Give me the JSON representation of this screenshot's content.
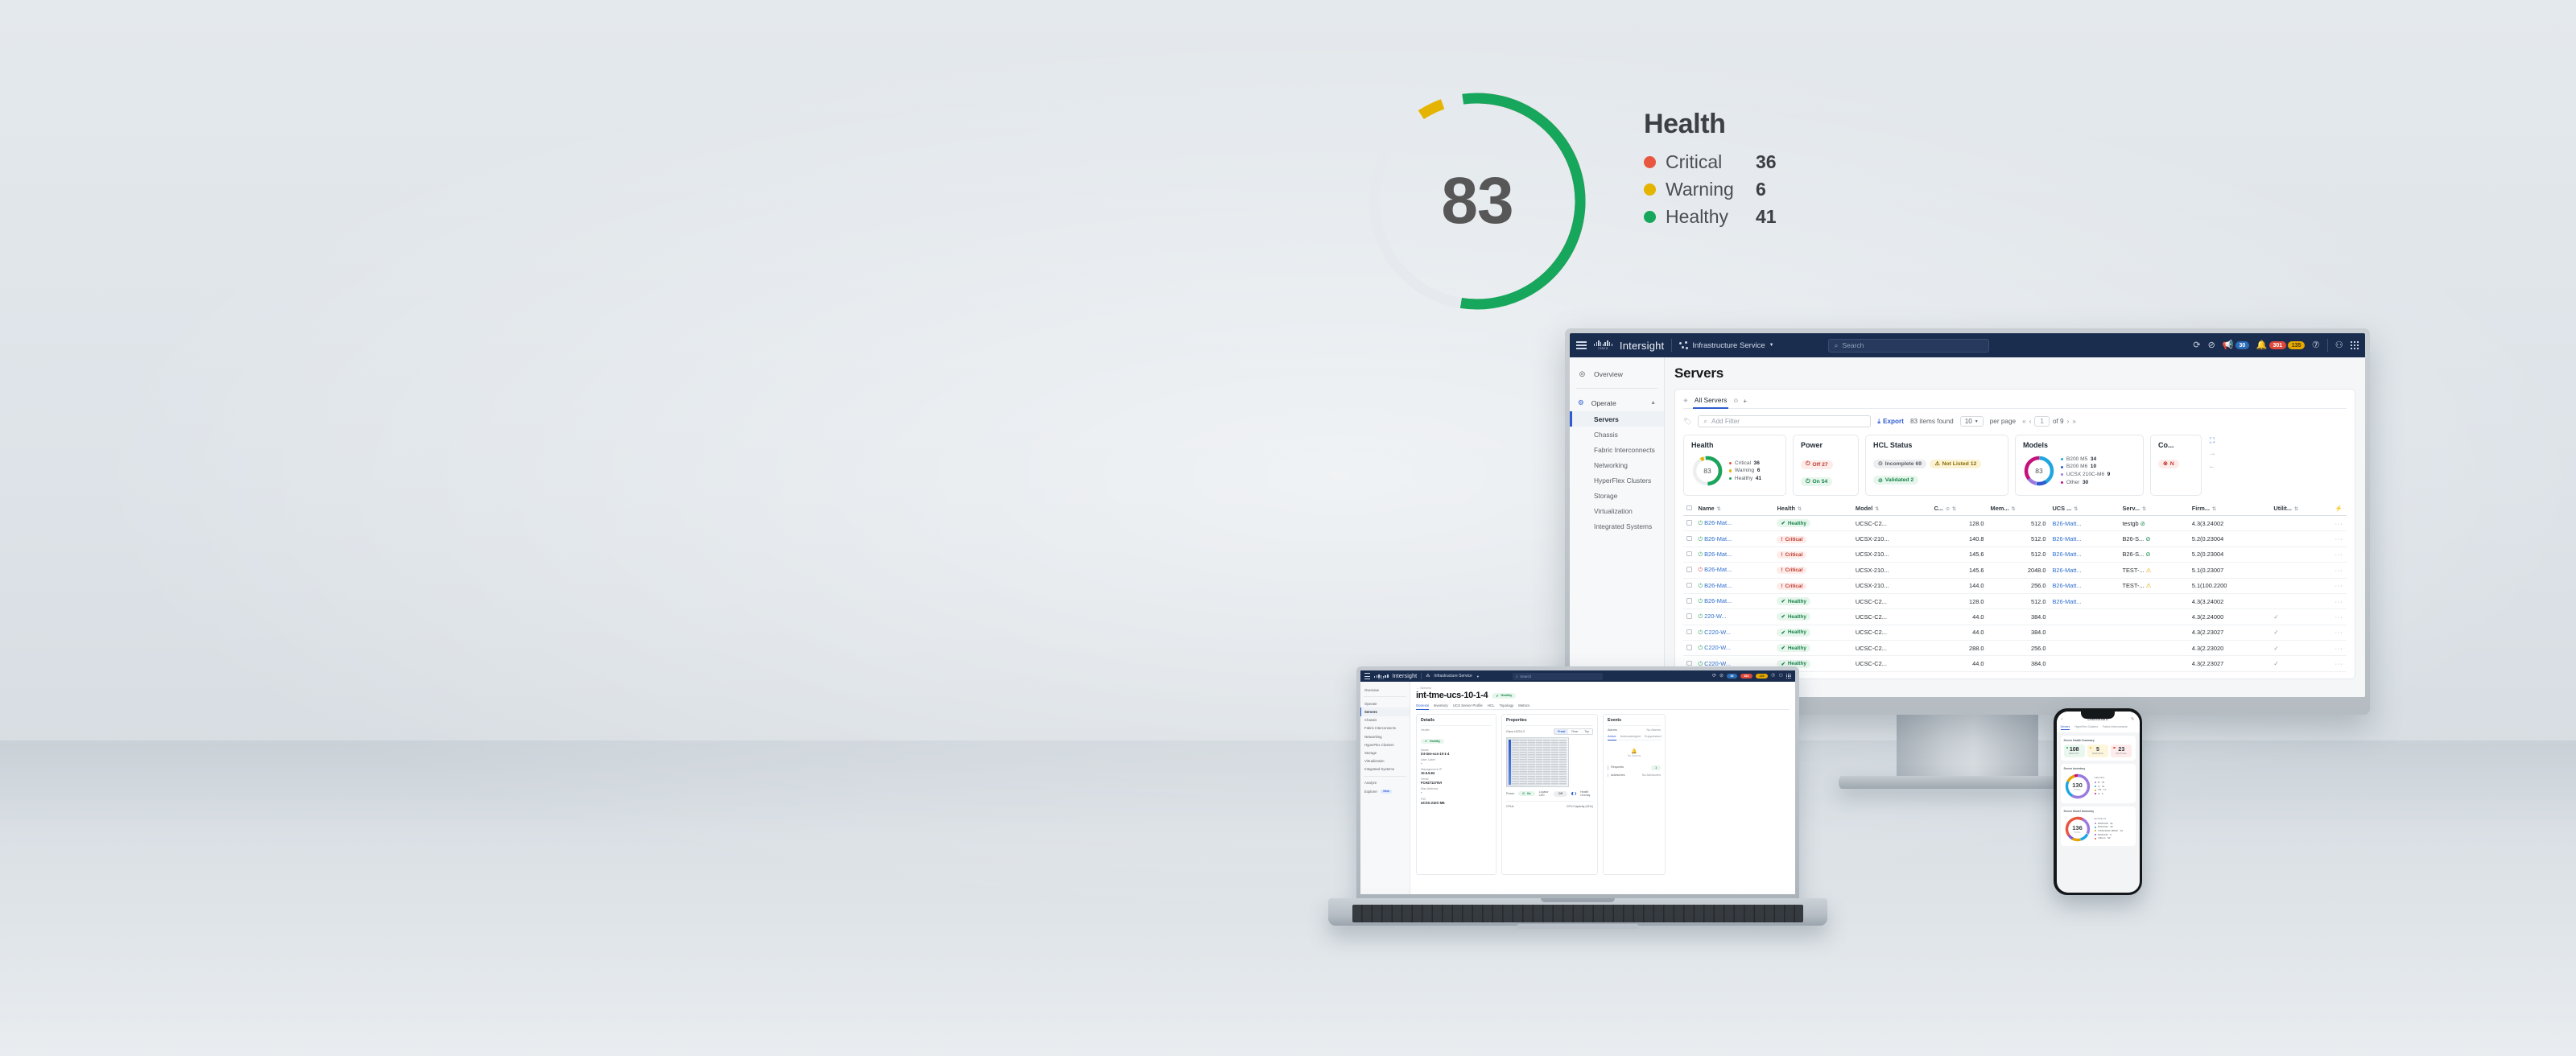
{
  "hero": {
    "score": "83",
    "title": "Health",
    "legend": [
      {
        "label": "Critical",
        "value": "36",
        "color": "#e8563f"
      },
      {
        "label": "Warning",
        "value": "6",
        "color": "#e5b400"
      },
      {
        "label": "Healthy",
        "value": "41",
        "color": "#16a75c"
      }
    ]
  },
  "topbar": {
    "brand": "Intersight",
    "cisco": "cisco",
    "service": "Infrastructure Service",
    "search_placeholder": "Search",
    "badges": [
      {
        "name": "announcements",
        "value": "30",
        "style": "blue"
      },
      {
        "name": "alarms-critical",
        "value": "301",
        "style": "red"
      },
      {
        "name": "alarms-warning",
        "value": "135",
        "style": "amber"
      }
    ]
  },
  "sidebar": {
    "overview": "Overview",
    "operate": "Operate",
    "items": [
      {
        "label": "Servers",
        "active": true
      },
      {
        "label": "Chassis",
        "active": false
      },
      {
        "label": "Fabric Interconnects",
        "active": false
      },
      {
        "label": "Networking",
        "active": false
      },
      {
        "label": "HyperFlex Clusters",
        "active": false
      },
      {
        "label": "Storage",
        "active": false
      },
      {
        "label": "Virtualization",
        "active": false
      },
      {
        "label": "Integrated Systems",
        "active": false
      }
    ]
  },
  "servers_page": {
    "title": "Servers",
    "tab": "All Servers",
    "add_tab": "+",
    "filter_placeholder": "Add Filter",
    "export": "Export",
    "items_found": "83 items found",
    "per_page_value": "10",
    "per_page_label": "per page",
    "page_value": "1",
    "page_of": "of 9"
  },
  "summary": {
    "health": {
      "title": "Health",
      "score": "83",
      "legend": [
        {
          "label": "Critical",
          "value": "36",
          "color": "#e8563f"
        },
        {
          "label": "Warning",
          "value": "6",
          "color": "#e5b400"
        },
        {
          "label": "Healthy",
          "value": "41",
          "color": "#16a75c"
        }
      ]
    },
    "power": {
      "title": "Power",
      "off": "Off 27",
      "on": "On 54"
    },
    "hcl": {
      "title": "HCL Status",
      "incomplete": "Incomplete 69",
      "not_listed": "Not Listed 12",
      "validated": "Validated 2"
    },
    "models": {
      "title": "Models",
      "total": "83",
      "legend": [
        {
          "label": "B200 M5",
          "value": "34",
          "color": "#1fa6e0"
        },
        {
          "label": "B200 M6",
          "value": "10",
          "color": "#2f5bd0"
        },
        {
          "label": "UCSX 210C-M6",
          "value": "9",
          "color": "#9b7ae0"
        },
        {
          "label": "Other",
          "value": "30",
          "color": "#c4127d"
        }
      ]
    },
    "connectivity": {
      "title": "Co...",
      "status": "N"
    }
  },
  "table": {
    "columns": [
      "Name",
      "Health",
      "Model",
      "C...",
      "Mem...",
      "UCS ...",
      "Serv...",
      "Firm...",
      "Utilit..."
    ],
    "rows": [
      {
        "power": "on",
        "name": "B26-Mat...",
        "health": "Healthy",
        "model": "UCSC-C2...",
        "cpu": "128.0",
        "mem": "512.0",
        "ucs": "B26-Matt...",
        "server": "testgb",
        "server_icon": "ok",
        "firmware": "4.3(3.24002",
        "util": ""
      },
      {
        "power": "on",
        "name": "B26-Mat...",
        "health": "Critical",
        "model": "UCSX-210...",
        "cpu": "140.8",
        "mem": "512.0",
        "ucs": "B26-Matt...",
        "server": "B26-S...",
        "server_icon": "ok",
        "firmware": "5.2(0.23004",
        "util": ""
      },
      {
        "power": "on",
        "name": "B26-Mat...",
        "health": "Critical",
        "model": "UCSX-210...",
        "cpu": "145.6",
        "mem": "512.0",
        "ucs": "B26-Matt...",
        "server": "B26-S...",
        "server_icon": "ok",
        "firmware": "5.2(0.23004",
        "util": ""
      },
      {
        "power": "off",
        "name": "B26-Mat...",
        "health": "Critical",
        "model": "UCSX-210...",
        "cpu": "145.6",
        "mem": "2048.0",
        "ucs": "B26-Matt...",
        "server": "TEST-...",
        "server_icon": "warn",
        "firmware": "5.1(0.23007",
        "util": ""
      },
      {
        "power": "on",
        "name": "B26-Mat...",
        "health": "Critical",
        "model": "UCSX-210...",
        "cpu": "144.0",
        "mem": "256.0",
        "ucs": "B26-Matt...",
        "server": "TEST-...",
        "server_icon": "warn",
        "firmware": "5.1(100.2200",
        "util": ""
      },
      {
        "power": "on",
        "name": "B26-Mat...",
        "health": "Healthy",
        "model": "UCSC-C2...",
        "cpu": "128.0",
        "mem": "512.0",
        "ucs": "B26-Matt...",
        "server": "",
        "server_icon": "",
        "firmware": "4.3(3.24002",
        "util": ""
      },
      {
        "power": "on",
        "name": "220-W...",
        "health": "Healthy",
        "model": "UCSC-C2...",
        "cpu": "44.0",
        "mem": "384.0",
        "ucs": "",
        "server": "",
        "server_icon": "",
        "firmware": "4.3(2.24000",
        "util": "check"
      },
      {
        "power": "on",
        "name": "C220-W...",
        "health": "Healthy",
        "model": "UCSC-C2...",
        "cpu": "44.0",
        "mem": "384.0",
        "ucs": "",
        "server": "",
        "server_icon": "",
        "firmware": "4.3(2.23027",
        "util": "check"
      },
      {
        "power": "on",
        "name": "C220-W...",
        "health": "Healthy",
        "model": "UCSC-C2...",
        "cpu": "288.0",
        "mem": "256.0",
        "ucs": "",
        "server": "",
        "server_icon": "",
        "firmware": "4.3(2.23020",
        "util": "check"
      },
      {
        "power": "on",
        "name": "C220-W...",
        "health": "Healthy",
        "model": "UCSC-C2...",
        "cpu": "44.0",
        "mem": "384.0",
        "ucs": "",
        "server": "",
        "server_icon": "",
        "firmware": "4.3(2.23027",
        "util": "check"
      }
    ]
  },
  "laptop": {
    "back_link": "Servers",
    "server_name": "int-tme-ucs-10-1-4",
    "health_badge": "Healthy",
    "tabs": [
      "General",
      "Inventory",
      "UCS Server Profile",
      "HCL",
      "Topology",
      "Metrics"
    ],
    "sidebar": {
      "overview": "Overview",
      "operate": "Operate",
      "items": [
        "Servers",
        "Chassis",
        "Fabric Interconnects",
        "Networking",
        "HyperFlex Clusters",
        "Storage",
        "Virtualization",
        "Integrated Systems"
      ],
      "analyze": "Analyze",
      "explorer": "Explorer",
      "explorer_badge": "New"
    },
    "details": {
      "title": "Details",
      "health_key": "Health",
      "health_value": "Healthy",
      "name_key": "Name",
      "name_value": "int-tme-ucs-10-1-4",
      "label_key": "User Label",
      "label_value": "-",
      "mgmt_key": "Management IP",
      "mgmt_value": "10.5.5.84",
      "serial_key": "Serial",
      "serial_value": "FCH2711Y5VI",
      "mac_key": "Mac Address",
      "mac_value": "-",
      "pid_key": "PID",
      "pid_value": "UCSX-210C-M6"
    },
    "properties": {
      "title": "Properties",
      "model": "Cisco UCSX-2",
      "views": [
        "Front",
        "Rear",
        "Top"
      ],
      "view_active": "Front",
      "power_key": "Power",
      "power_value": "On",
      "locator_key": "Locator LED",
      "locator_value": "Off",
      "overlay_label": "Health Overlay",
      "cpus_key": "CPUs",
      "cpu_capacity_key": "CPU Capacity (GHz)"
    },
    "events": {
      "title": "Events",
      "alarms_key": "Alarms",
      "alarms_value": "No Alarms",
      "tabs": [
        "Active",
        "Acknowledged",
        "Suppressed"
      ],
      "empty": "No Alarms",
      "requests_key": "Requests",
      "requests_value": "1",
      "advisories_key": "Advisories",
      "advisories_value": "No Advisories"
    }
  },
  "phone": {
    "nav_title": "Dashboard",
    "tabs": [
      "Servers",
      "HyperFlex Clusters",
      "Fabric Interconnects"
    ],
    "health": {
      "title": "Server Health Summary",
      "stats": [
        {
          "value": "108",
          "label": "HEALTHY",
          "color": "#16a75c",
          "tone": "g"
        },
        {
          "value": "5",
          "label": "WARNING",
          "color": "#e5b400",
          "tone": "y"
        },
        {
          "value": "23",
          "label": "CRITICAL",
          "color": "#e8563f",
          "tone": "r"
        }
      ]
    },
    "inventory": {
      "title": "Server Inventory",
      "total": "130",
      "total_label": "TOTAL",
      "legend_title": "SERIES",
      "legend": [
        {
          "label": "B",
          "value": "76",
          "color": "#9b7ae0"
        },
        {
          "label": "C",
          "value": "31",
          "color": "#1fa6e0"
        },
        {
          "label": "HX",
          "value": "17",
          "color": "#e5a400"
        },
        {
          "label": "S",
          "value": "6",
          "color": "#c4127d"
        }
      ]
    },
    "models": {
      "title": "Server Model Summary",
      "total": "136",
      "total_label": "TOTAL",
      "legend_title": "MODELS",
      "legend": [
        {
          "label": "B200 M5",
          "value": "44",
          "color": "#9b7ae0"
        },
        {
          "label": "B200 M4",
          "value": "18",
          "color": "#1fa6e0"
        },
        {
          "label": "HXAF220C M5SX",
          "value": "16",
          "color": "#e5a400"
        },
        {
          "label": "B200 M3",
          "value": "9",
          "color": "#7e5ad4"
        },
        {
          "label": "Others",
          "value": "59",
          "color": "#e8563f"
        }
      ]
    }
  }
}
